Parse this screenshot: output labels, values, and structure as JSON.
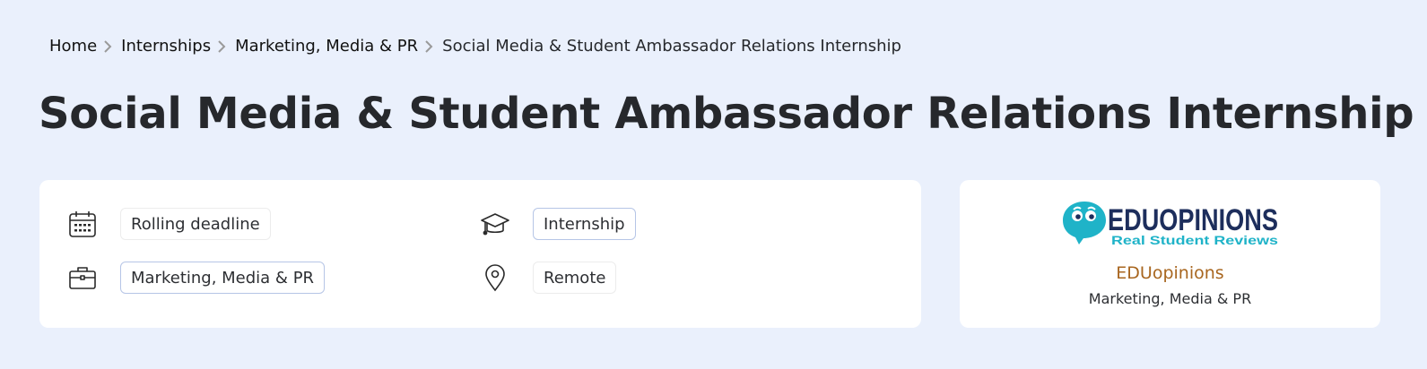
{
  "breadcrumb": {
    "items": [
      "Home",
      "Internships",
      "Marketing, Media & PR"
    ],
    "current": "Social Media & Student Ambassador Relations Internship"
  },
  "title": "Social Media & Student Ambassador Relations Internship",
  "details": {
    "deadline": {
      "icon": "calendar-icon",
      "label": "Rolling deadline"
    },
    "type": {
      "icon": "graduation-cap-icon",
      "label": "Internship"
    },
    "category": {
      "icon": "briefcase-icon",
      "label": "Marketing, Media & PR"
    },
    "location": {
      "icon": "map-pin-icon",
      "label": "Remote"
    }
  },
  "company": {
    "logo": {
      "brand_left": "EDU",
      "brand_right": "OPINIONS",
      "tagline": "Real Student Reviews"
    },
    "name": "EDUopinions",
    "category": "Marketing, Media & PR"
  },
  "colors": {
    "background": "#eaf0fc",
    "company_name": "#a8661f",
    "logo_teal": "#1fb3c8",
    "logo_navy": "#1d2e5c"
  }
}
